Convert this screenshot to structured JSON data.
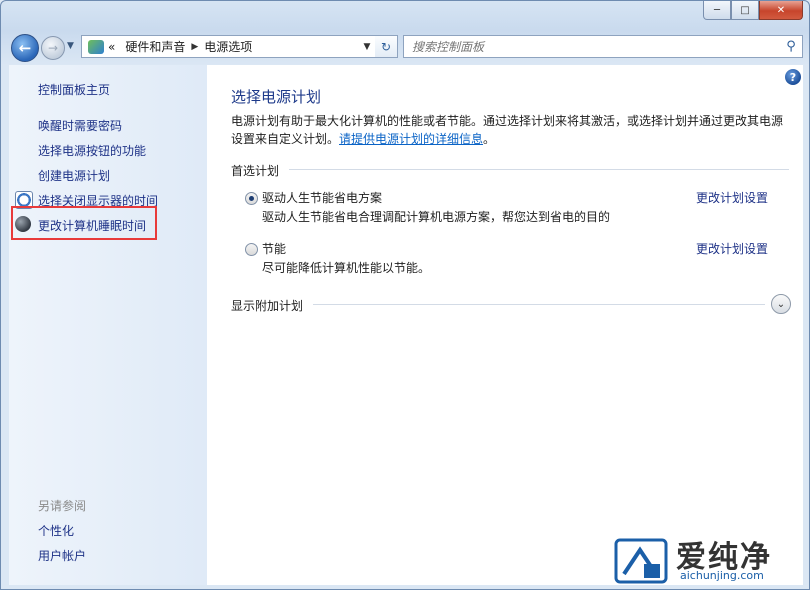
{
  "window": {
    "controls": {
      "minimize": "─",
      "maximize": "□",
      "close": "✕"
    }
  },
  "nav": {
    "back": "←",
    "forward": "→",
    "history_dropdown": "▼",
    "address_prefix": "«",
    "breadcrumb": [
      "硬件和声音",
      "电源选项"
    ],
    "breadcrumb_separator": "▶",
    "address_dropdown": "▼",
    "refresh": "↻",
    "search_placeholder": "搜索控制面板",
    "search_icon": "⚲"
  },
  "sidebar": {
    "items": [
      {
        "label": "控制面板主页"
      },
      {
        "label": "唤醒时需要密码"
      },
      {
        "label": "选择电源按钮的功能"
      },
      {
        "label": "创建电源计划"
      },
      {
        "label": "选择关闭显示器的时间",
        "icon": "clock-icon"
      },
      {
        "label": "更改计算机睡眠时间",
        "icon": "moon-icon",
        "highlighted": true
      }
    ],
    "see_also": {
      "heading": "另请参阅",
      "items": [
        {
          "label": "个性化"
        },
        {
          "label": "用户帐户"
        }
      ]
    }
  },
  "main": {
    "help": "?",
    "title": "选择电源计划",
    "description": "电源计划有助于最大化计算机的性能或者节能。通过选择计划来将其激活，或选择计划并通过更改其电源设置来自定义计划。",
    "description_link": "请提供电源计划的详细信息",
    "description_end": "。",
    "preferred_heading": "首选计划",
    "plans": [
      {
        "name": "驱动人生节能省电方案",
        "description": "驱动人生节能省电合理调配计算机电源方案，帮您达到省电的目的",
        "selected": true,
        "link": "更改计划设置"
      },
      {
        "name": "节能",
        "description": "尽可能降低计算机性能以节能。",
        "selected": false,
        "link": "更改计划设置"
      }
    ],
    "additional_heading": "显示附加计划",
    "expand": "⌄"
  },
  "watermark": {
    "title": "爱纯净",
    "url": "aichunjing.com"
  }
}
